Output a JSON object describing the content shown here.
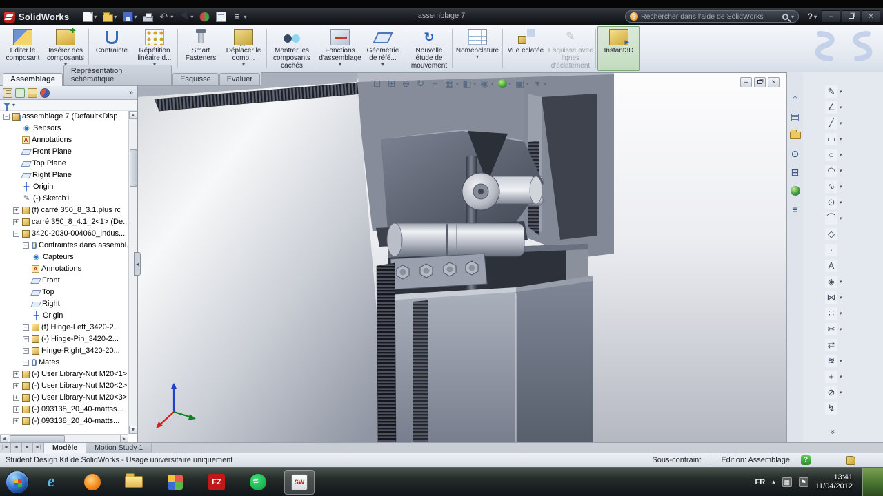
{
  "titlebar": {
    "app_name": "SolidWorks",
    "doc_title": "assemblage 7",
    "help_label": "?",
    "search_placeholder": "Rechercher dans l'aide de SolidWorks",
    "qat": [
      {
        "name": "new-document",
        "arrow": true
      },
      {
        "name": "open",
        "arrow": true
      },
      {
        "name": "save",
        "arrow": true
      },
      {
        "name": "print",
        "arrow": false
      },
      {
        "name": "undo",
        "arrow": true
      },
      {
        "name": "select",
        "arrow": true
      },
      {
        "name": "rebuild",
        "arrow": false
      },
      {
        "name": "file-properties",
        "arrow": false
      },
      {
        "name": "options",
        "arrow": true
      }
    ]
  },
  "ribbon": {
    "buttons": [
      {
        "label": "Editer le composant",
        "icon": "edit-component",
        "arrow": false
      },
      {
        "label": "Insérer des composants",
        "icon": "insert-components",
        "arrow": true
      },
      {
        "label": "Contrainte",
        "icon": "mate",
        "arrow": false,
        "sep": true
      },
      {
        "label": "Répétition linéaire d...",
        "icon": "linear-pattern",
        "arrow": true
      },
      {
        "label": "Smart Fasteners",
        "icon": "smart-fasteners",
        "arrow": false,
        "sep": true
      },
      {
        "label": "Déplacer le comp...",
        "icon": "move-component",
        "arrow": true
      },
      {
        "label": "Montrer les composants cachés",
        "icon": "show-hidden",
        "arrow": false,
        "sep": true,
        "wide": true
      },
      {
        "label": "Fonctions d'assemblage",
        "icon": "assembly-features",
        "arrow": true,
        "sep": true
      },
      {
        "label": "Géométrie de réfé...",
        "icon": "reference-geometry",
        "arrow": true
      },
      {
        "label": "Nouvelle étude de mouvement",
        "icon": "motion-study",
        "arrow": false,
        "sep": true
      },
      {
        "label": "Nomenclature",
        "icon": "bom",
        "arrow": true,
        "sep": true,
        "wide": true
      },
      {
        "label": "Vue éclatée",
        "icon": "exploded-view",
        "arrow": false,
        "sep": true
      },
      {
        "label": "Esquisse avec lignes d'éclatement",
        "icon": "explode-sketch",
        "arrow": false,
        "disabled": true,
        "wide": true
      },
      {
        "label": "Instant3D",
        "icon": "instant3d",
        "arrow": false,
        "sep": true,
        "active": true
      }
    ]
  },
  "commandmanager_tabs": [
    {
      "label": "Assemblage",
      "active": true
    },
    {
      "label": "Représentation schématique",
      "active": false
    },
    {
      "label": "Esquisse",
      "active": false
    },
    {
      "label": "Evaluer",
      "active": false
    }
  ],
  "feature_tree": {
    "overflow_label": "»",
    "items": [
      {
        "label": "assemblage 7 (Default<Disp",
        "level": 0,
        "icon": "assembly",
        "expand": "-"
      },
      {
        "label": "Sensors",
        "level": 1,
        "icon": "sensors",
        "expand": ""
      },
      {
        "label": "Annotations",
        "level": 1,
        "icon": "annotations",
        "expand": ""
      },
      {
        "label": "Front Plane",
        "level": 1,
        "icon": "plane",
        "expand": ""
      },
      {
        "label": "Top Plane",
        "level": 1,
        "icon": "plane",
        "expand": ""
      },
      {
        "label": "Right Plane",
        "level": 1,
        "icon": "plane",
        "expand": ""
      },
      {
        "label": "Origin",
        "level": 1,
        "icon": "origin",
        "expand": ""
      },
      {
        "label": "(-) Sketch1",
        "level": 1,
        "icon": "sketch",
        "expand": ""
      },
      {
        "label": "(f) carré 350_8_3.1.plus rc",
        "level": 1,
        "icon": "part",
        "expand": "+"
      },
      {
        "label": "carré 350_8_4.1_2<1> (De...",
        "level": 1,
        "icon": "part",
        "expand": "+"
      },
      {
        "label": "3420-2030-004060_Indus...",
        "level": 1,
        "icon": "assembly",
        "expand": "-"
      },
      {
        "label": "Contraintes dans assembl...",
        "level": 2,
        "icon": "mates-folder",
        "expand": "+"
      },
      {
        "label": "Capteurs",
        "level": 2,
        "icon": "sensors",
        "expand": ""
      },
      {
        "label": "Annotations",
        "level": 2,
        "icon": "annotations",
        "expand": ""
      },
      {
        "label": "Front",
        "level": 2,
        "icon": "plane",
        "expand": ""
      },
      {
        "label": "Top",
        "level": 2,
        "icon": "plane",
        "expand": ""
      },
      {
        "label": "Right",
        "level": 2,
        "icon": "plane",
        "expand": ""
      },
      {
        "label": "Origin",
        "level": 2,
        "icon": "origin",
        "expand": ""
      },
      {
        "label": "(f) Hinge-Left_3420-2...",
        "level": 2,
        "icon": "part",
        "expand": "+"
      },
      {
        "label": "(-) Hinge-Pin_3420-2...",
        "level": 2,
        "icon": "part",
        "expand": "+"
      },
      {
        "label": "Hinge-Right_3420-20...",
        "level": 2,
        "icon": "part",
        "expand": "+"
      },
      {
        "label": "Mates",
        "level": 2,
        "icon": "mates",
        "expand": "+"
      },
      {
        "label": "(-) User Library-Nut M20<1>",
        "level": 1,
        "icon": "part",
        "expand": "+"
      },
      {
        "label": "(-) User Library-Nut M20<2>",
        "level": 1,
        "icon": "part",
        "expand": "+"
      },
      {
        "label": "(-) User Library-Nut M20<3>",
        "level": 1,
        "icon": "part",
        "expand": "+"
      },
      {
        "label": "(-) 093138_20_40-mattss...",
        "level": 1,
        "icon": "part",
        "expand": "+"
      },
      {
        "label": "(-) 093138_20_40-matts...",
        "level": 1,
        "icon": "part",
        "expand": "+"
      }
    ]
  },
  "viewport_hud": [
    {
      "name": "zoom-fit",
      "arrow": false
    },
    {
      "name": "zoom-area",
      "arrow": false
    },
    {
      "name": "zoom",
      "arrow": false
    },
    {
      "name": "rotate-view",
      "arrow": false
    },
    {
      "name": "pan",
      "arrow": false
    },
    {
      "name": "view-orientation",
      "arrow": true
    },
    {
      "name": "display-style",
      "arrow": true
    },
    {
      "name": "hide-show-items",
      "arrow": true
    },
    {
      "name": "edit-appearance",
      "arrow": true
    },
    {
      "name": "apply-scene",
      "arrow": true
    },
    {
      "name": "view-settings",
      "arrow": true
    }
  ],
  "task_pane_icons": [
    "solidworks-resources",
    "design-library",
    "file-explorer",
    "search",
    "view-palette",
    "appearances-scenes",
    "custom-properties"
  ],
  "right_toolbar": {
    "more_label": "»",
    "items": [
      {
        "name": "sketch",
        "arrow": true
      },
      {
        "name": "smart-dimension",
        "arrow": true
      },
      {
        "name": "line",
        "arrow": true
      },
      {
        "name": "rectangle",
        "arrow": true
      },
      {
        "name": "circle",
        "arrow": true
      },
      {
        "name": "arc",
        "arrow": true
      },
      {
        "name": "spline",
        "arrow": true
      },
      {
        "name": "ellipse",
        "arrow": true
      },
      {
        "name": "sketch-fillet",
        "arrow": true
      },
      {
        "name": "polygon",
        "arrow": false
      },
      {
        "name": "point",
        "arrow": false
      },
      {
        "name": "text",
        "arrow": false
      },
      {
        "name": "plane",
        "arrow": true
      },
      {
        "name": "mirror-entities",
        "arrow": true
      },
      {
        "name": "linear-sketch-pattern",
        "arrow": true
      },
      {
        "name": "trim-entities",
        "arrow": true
      },
      {
        "name": "convert-entities",
        "arrow": false
      },
      {
        "name": "offset-entities",
        "arrow": true
      },
      {
        "name": "move-entities",
        "arrow": true
      },
      {
        "name": "display-delete-relations",
        "arrow": true
      },
      {
        "name": "repair-sketch",
        "arrow": false
      }
    ]
  },
  "bottom_tabs": {
    "scroll_buttons": [
      {
        "name": "first",
        "glyph": "|◄"
      },
      {
        "name": "previous",
        "glyph": "◄"
      },
      {
        "name": "next",
        "glyph": "►"
      },
      {
        "name": "last",
        "glyph": "►|"
      }
    ],
    "tabs": [
      {
        "label": "Modèle",
        "active": true
      },
      {
        "label": "Motion Study 1",
        "active": false
      }
    ]
  },
  "statusbar": {
    "license_text": "Student Design Kit de SolidWorks - Usage universitaire uniquement",
    "constraint_status": "Sous-contraint",
    "edit_mode": "Edition: Assemblage"
  },
  "taskbar": {
    "apps": [
      {
        "name": "internet-explorer",
        "active": false
      },
      {
        "name": "firefox",
        "active": false
      },
      {
        "name": "file-explorer",
        "active": false
      },
      {
        "name": "media-app",
        "active": false
      },
      {
        "name": "filezilla",
        "active": false
      },
      {
        "name": "spotify",
        "active": false
      },
      {
        "name": "solidworks",
        "active": true
      }
    ],
    "tray": {
      "language": "FR",
      "time": "13:41",
      "date": "11/04/2012"
    }
  }
}
